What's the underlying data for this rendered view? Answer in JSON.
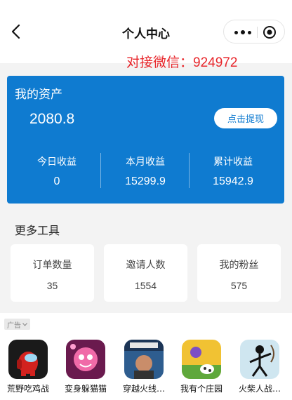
{
  "nav": {
    "title": "个人中心",
    "icons": [
      "back-arrow-icon",
      "more-dots-icon",
      "target-icon"
    ]
  },
  "contact_text": "对接微信：924972",
  "asset": {
    "title": "我的资产",
    "amount": "2080.8",
    "withdraw_label": "点击提现",
    "stats": [
      {
        "label": "今日收益",
        "value": "0"
      },
      {
        "label": "本月收益",
        "value": "15299.9"
      },
      {
        "label": "累计收益",
        "value": "15942.9"
      }
    ]
  },
  "tools": {
    "title": "更多工具",
    "items": [
      {
        "label": "订单数量",
        "value": "35"
      },
      {
        "label": "邀请人数",
        "value": "1554"
      },
      {
        "label": "我的粉丝",
        "value": "575"
      }
    ]
  },
  "ad": {
    "tag": "广告",
    "apps": [
      {
        "name": "荒野吃鸡战"
      },
      {
        "name": "变身躲猫猫"
      },
      {
        "name": "穿越火线…"
      },
      {
        "name": "我有个庄园"
      },
      {
        "name": "火柴人战…"
      }
    ]
  },
  "colors": {
    "accent": "#0f7bd0",
    "contact": "#e8262b",
    "background": "#f3f3f3"
  }
}
